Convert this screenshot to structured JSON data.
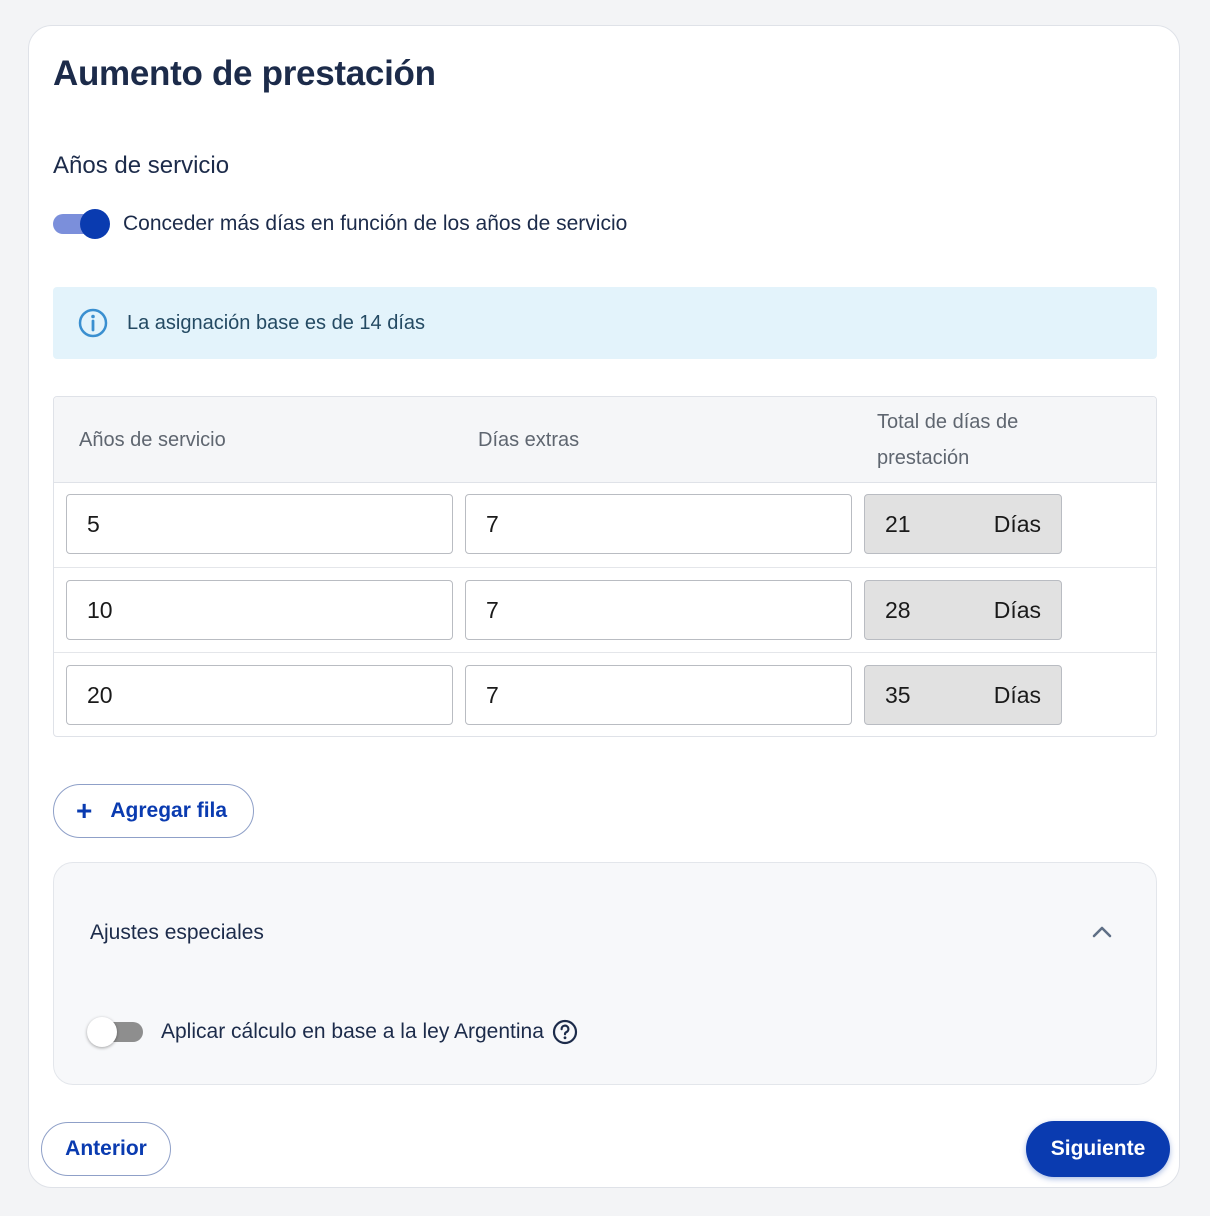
{
  "page": {
    "title": "Aumento de prestación",
    "section_title": "Años de servicio"
  },
  "service_toggle": {
    "label": "Conceder más días en función de los años de servicio",
    "checked": true
  },
  "info": {
    "icon": "info-icon",
    "text": "La asignación base es de 14 días"
  },
  "table": {
    "headers": [
      "Años de servicio",
      "Días extras",
      "Total de días de prestación"
    ],
    "rows": [
      {
        "years": "5",
        "extra": "7",
        "total": "21",
        "unit": "Días"
      },
      {
        "years": "10",
        "extra": "7",
        "total": "28",
        "unit": "Días"
      },
      {
        "years": "20",
        "extra": "7",
        "total": "35",
        "unit": "Días"
      }
    ]
  },
  "add_row": {
    "icon": "plus-icon",
    "label": "Agregar fila"
  },
  "special": {
    "title": "Ajustes especiales",
    "expanded": true,
    "toggle_label": "Aplicar cálculo en base a la ley Argentina",
    "toggle_checked": false
  },
  "footer": {
    "prev_label": "Anterior",
    "next_label": "Siguiente"
  },
  "colors": {
    "primary": "#0a3bb0",
    "info_bg": "#e3f3fb",
    "text": "#1c2b4a"
  }
}
